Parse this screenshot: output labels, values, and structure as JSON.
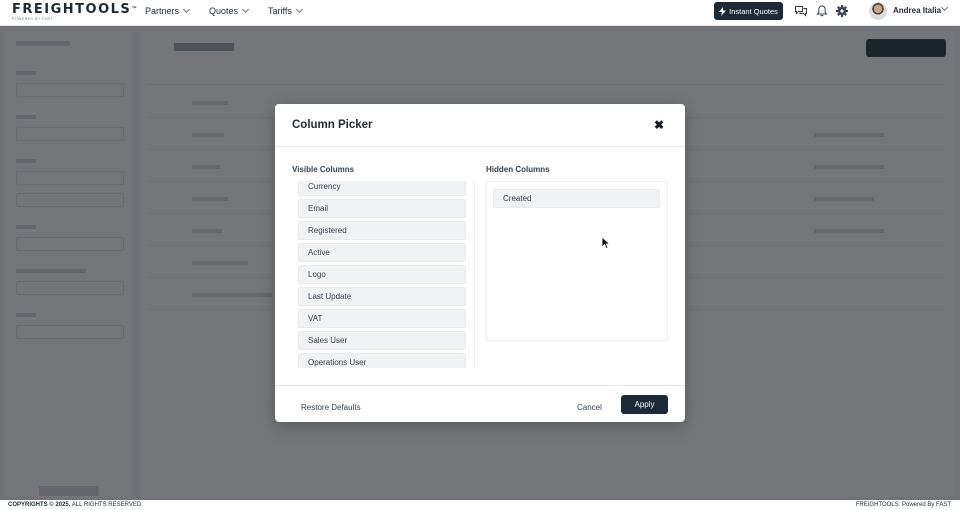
{
  "brand": {
    "name": "FREIGHTOOLS",
    "tm": "™",
    "tagline": "POWERED BY FAST"
  },
  "nav": {
    "menu": [
      {
        "label": "Partners"
      },
      {
        "label": "Quotes"
      },
      {
        "label": "Tariffs"
      }
    ],
    "instant_quotes_label": "Instant Quotes",
    "user_name": "Andrea Italia"
  },
  "modal": {
    "title": "Column Picker",
    "visible_heading": "Visible Columns",
    "hidden_heading": "Hidden Columns",
    "visible_columns": [
      "Currency",
      "Email",
      "Registered",
      "Active",
      "Logo",
      "Last Update",
      "VAT",
      "Sales User",
      "Operations User"
    ],
    "hidden_columns": [
      "Created"
    ],
    "restore_label": "Restore Defaults",
    "cancel_label": "Cancel",
    "apply_label": "Apply"
  },
  "footer": {
    "copyright": "COPYRIGHTS © 2025.",
    "rights": "ALL RIGHTS RESERVED.",
    "right_text": "FREIGHTOOLS. Powered By FAST"
  },
  "colors": {
    "primary": "#1b2a36",
    "overlay": "#1e2228"
  }
}
